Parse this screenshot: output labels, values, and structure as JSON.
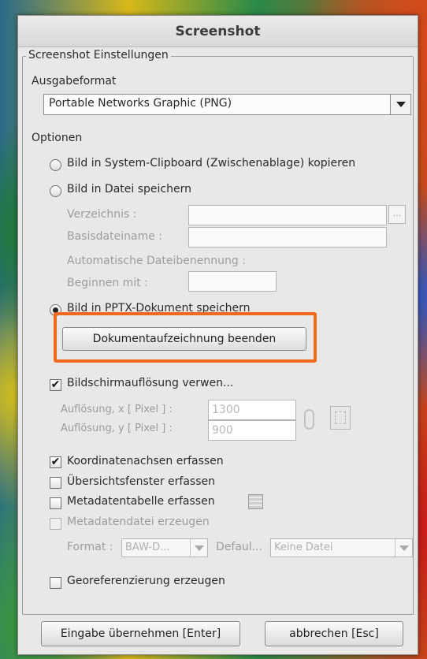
{
  "window": {
    "title": "Screenshot"
  },
  "settings": {
    "legend": "Screenshot Einstellungen",
    "output_format_label": "Ausgabeformat",
    "output_format_value": "Portable Networks Graphic (PNG)",
    "options_label": "Optionen",
    "radio_clipboard": "Bild in System-Clipboard (Zwischenablage) kopieren",
    "radio_file": "Bild in Datei speichern",
    "directory_label": "Verzeichnis :",
    "directory_browse": "...",
    "basename_label": "Basisdateiname :",
    "auto_naming_label": "Automatische Dateibenennung :",
    "start_with_label": "Beginnen mit :",
    "radio_pptx": "Bild in PPTX-Dokument speichern",
    "stop_recording_button": "Dokumentaufzeichnung beenden",
    "use_screen_resolution": "Bildschirmauflösung verwen...",
    "res_x_label": "Auflösung, x [ Pixel ] :",
    "res_x_value": "1300",
    "res_y_label": "Auflösung, y [ Pixel ] :",
    "res_y_value": "900",
    "capture_axes": "Koordinatenachsen erfassen",
    "capture_overview": "Übersichtsfenster erfassen",
    "capture_metadata_table": "Metadatentabelle erfassen",
    "create_metadata_file": "Metadatendatei erzeugen",
    "format_label": "Format :",
    "format_value": "BAW-D...",
    "default_label": "Defaul...",
    "default_value": "Keine Datei",
    "georeferencing": "Georeferenzierung erzeugen"
  },
  "footer": {
    "ok_button": "Eingabe übernehmen [Enter]",
    "cancel_button": "abbrechen [Esc]"
  },
  "state": {
    "selected_radio": "pptx",
    "use_screen_resolution": true,
    "capture_axes": true,
    "capture_overview": false,
    "capture_metadata_table": false,
    "create_metadata_file": false,
    "georeferencing": false
  },
  "colors": {
    "highlight": "#f06a1e"
  }
}
